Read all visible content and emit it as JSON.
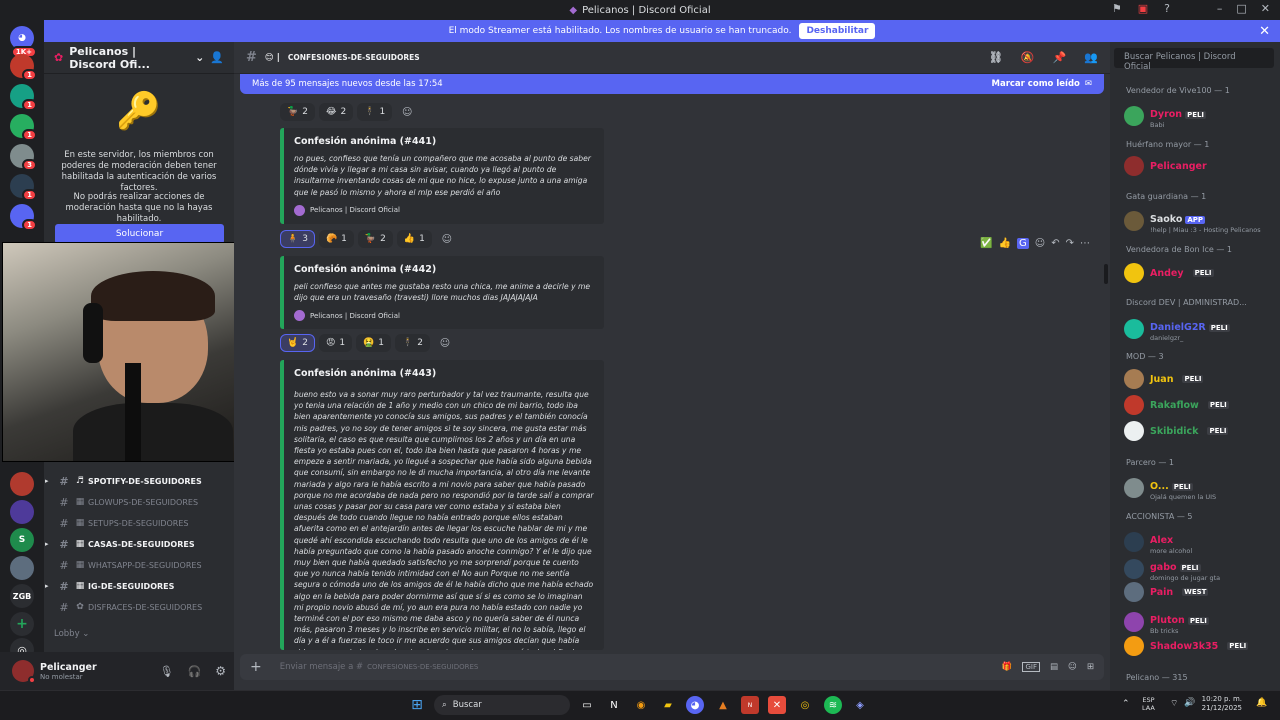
{
  "window": {
    "title": "Pelicanos | Discord Oficial"
  },
  "banner": {
    "text": "El modo Streamer está habilitado. Los nombres de usuario se han truncado.",
    "button": "Deshabilitar"
  },
  "servers": [
    {
      "label": "1K+"
    },
    {
      "label": "1"
    },
    {
      "label": "1"
    },
    {
      "label": "1"
    },
    {
      "label": "3"
    },
    {
      "label": "1"
    },
    {
      "label": "1"
    }
  ],
  "server_list_bottom": {
    "s_label": "S",
    "zgb_label": "ZGB",
    "add": "+"
  },
  "sidebar": {
    "server_name": "Pelicanos | Discord Ofi...",
    "permission_text_1": "En este servidor, los miembros con poderes de moderación deben tener habilitada la autenticación de varios factores.",
    "permission_text_2": "No podrás realizar acciones de moderación hasta que no la hayas habilitado.",
    "solve_button": "Solucionar",
    "channels": [
      {
        "emoji": "♬",
        "name": "spotify-de-seguidores",
        "bold": true
      },
      {
        "emoji": "▦",
        "name": "glowups-de-seguidores",
        "bold": false
      },
      {
        "emoji": "▦",
        "name": "setups-de-seguidores",
        "bold": false
      },
      {
        "emoji": "▦",
        "name": "casas-de-seguidores",
        "bold": true
      },
      {
        "emoji": "▦",
        "name": "whatsapp-de-seguidores",
        "bold": false
      },
      {
        "emoji": "▦",
        "name": "ig-de-seguidores",
        "bold": true
      },
      {
        "emoji": "✿",
        "name": "disfraces-de-seguidores",
        "bold": false
      }
    ],
    "lobby": "Lobby"
  },
  "user": {
    "name": "Pelicanger",
    "status": "No molestar"
  },
  "chat": {
    "channel_name": "confesiones-de-seguidores",
    "new_messages": "Más de 95 mensajes nuevos desde las 17:54",
    "mark_read": "Marcar como leído",
    "top_reactions": [
      {
        "e": "🦆",
        "c": "2"
      },
      {
        "e": "😂",
        "c": "2"
      },
      {
        "e": "🕴",
        "c": "1"
      }
    ],
    "messages": [
      {
        "title": "Confesión anónima (#441)",
        "body": "no pues, confieso que tenía un compañero que me acosaba al punto de saber dónde vivía y llegar a mi casa sin avisar, cuando ya llegó al punto de insultarme inventando cosas de mi que no hice, lo expuse junto a una amiga que le pasó lo mismo y ahora el mlp ese perdió el año",
        "footer": "Pelicanos | Discord Oficial",
        "reactions": [
          {
            "e": "🧍",
            "c": "3",
            "me": true
          },
          {
            "e": "🥐",
            "c": "1",
            "me": false
          },
          {
            "e": "🦆",
            "c": "2",
            "me": false
          },
          {
            "e": "👍",
            "c": "1",
            "me": false
          }
        ]
      },
      {
        "title": "Confesión anónima (#442)",
        "body": "peli confieso que antes me gustaba resto una chica, me anime a decirle y me dijo que era un travesaño (travesti) llore muchos dias JAJAJAJAJA",
        "footer": "Pelicanos | Discord Oficial",
        "reactions": [
          {
            "e": "🤘",
            "c": "2",
            "me": true
          },
          {
            "e": "😡",
            "c": "1",
            "me": false
          },
          {
            "e": "🤮",
            "c": "1",
            "me": false
          },
          {
            "e": "🕴",
            "c": "2",
            "me": false
          }
        ]
      },
      {
        "title": "Confesión anónima (#443)",
        "body": "bueno esto va a sonar muy raro perturbador y tal vez traumante, resulta que yo tenia una relación de 1 año y medio con un chico de mi barrio, todo iba bien aparentemente yo conocía sus amigos, sus padres y el también conocía mis padres, yo no soy de tener amigos si te soy sincera, me gusta estar más solitaria, el caso es que resulta que cumplimos los 2 años y un día en una fiesta yo estaba pues con el, todo iba bien hasta que pasaron 4 horas y me empeze a sentir mariada, yo llegué a sospechar que había sido alguna bebida que consumí, sin embargo no le di mucha importancia, al otro día me levante mariada y algo rara le había escrito a mi novio para saber que había pasado porque no me acordaba de nada pero no respondió por la tarde salí a comprar unas cosas y pasar por su casa para ver como estaba y si estaba bien después de todo cuando llegue no había entrado porque ellos estaban afuerita como en el antejardín antes de llegar los escuche hablar de mi y me quedé ahí escondida escuchando todo resulta que uno de los amigos de él le había preguntado que como la había pasado anoche conmigo? Y el le dijo que muy bien que había quedado satisfecho yo me sorprendí porque te cuento que yo nunca había tenido intimidad con el No aun Porque no me sentía segura o cómoda uno de los amigos de él le había dicho que me había echado algo en la bebida para poder dormirme así que sí si es como se lo imaginan mi propio novio abusó de mí, yo aun era pura no había estado con nadie yo terminé con el por eso mismo me daba asco y no quería saber de él nunca más, pasaron 3 meses y lo inscribe en servicio militar, el no lo sabía, llego el día y a él a fuerzas le toco ir me acuerdo que sus amigos decían que había sido yo, me echaban la culpa, igualmente yo siempre negué todo, al final volvió pero su vida no fue igual porque volvió con ambas piernas amputadas"
      }
    ],
    "composer_placeholder": "Enviar mensaje a #",
    "composer_channel": "confesiones-de-seguidores"
  },
  "members": {
    "search_placeholder": "Buscar Pelicanos | Discord Oficial",
    "groups": [
      {
        "role": "Vendedor de Vive100 — 1",
        "members": [
          {
            "name": "Dyron",
            "tag": "PELI",
            "sub": "Babi",
            "color": "#e91e63"
          }
        ]
      },
      {
        "role": "Huérfano mayor — 1",
        "members": [
          {
            "name": "Pelicanger",
            "tag": "",
            "sub": "",
            "color": "#e91e63"
          }
        ]
      },
      {
        "role": "Gata guardiana — 1",
        "members": [
          {
            "name": "Saoko",
            "tag": "APP",
            "sub": "!help | Miau :3 - Hosting Pelicanos",
            "color": "#dbdee1"
          }
        ]
      },
      {
        "role": "Vendedora de Bon Ice — 1",
        "members": [
          {
            "name": "Andey",
            "tag": "PELI",
            "sub": "",
            "color": "#e91e63"
          }
        ]
      },
      {
        "role": "Discord DEV | ADMINISTRAD...",
        "members": [
          {
            "name": "DanielG2R",
            "tag": "PELI",
            "sub": "danielgzr_",
            "color": "#5865f2"
          }
        ]
      },
      {
        "role": "MOD — 3",
        "members": [
          {
            "name": "Juan",
            "tag": "PELI",
            "sub": "",
            "color": "#f1c40f"
          },
          {
            "name": "Rakaflow",
            "tag": "PELI",
            "sub": "",
            "color": "#3ba55c"
          },
          {
            "name": "Skibidick",
            "tag": "PELI",
            "sub": "",
            "color": "#3ba55c"
          }
        ]
      },
      {
        "role": "Parcero — 1",
        "members": [
          {
            "name": "O...",
            "tag": "PELI",
            "sub": "Ojalá quemen la UIS",
            "color": "#f1c40f"
          }
        ]
      },
      {
        "role": "ACCIONISTA — 5",
        "members": [
          {
            "name": "Alex",
            "tag": "",
            "sub": "more alcohol",
            "color": "#e91e63"
          },
          {
            "name": "gabo",
            "tag": "PELI",
            "sub": "domingo de jugar gta",
            "color": "#e91e63"
          },
          {
            "name": "Pain",
            "tag": "WEST",
            "sub": "",
            "color": "#e91e63"
          },
          {
            "name": "Pluton",
            "tag": "PELI",
            "sub": "Bb tricks",
            "color": "#e91e63"
          },
          {
            "name": "Shadow3k35",
            "tag": "PELI",
            "sub": "",
            "color": "#e91e63"
          }
        ]
      },
      {
        "role": "Pelicano — 315",
        "members": []
      }
    ]
  },
  "taskbar": {
    "search": "Buscar",
    "lang": "ESP",
    "lang2": "LAA",
    "time": "10:20 p. m.",
    "date": "21/12/2025"
  }
}
